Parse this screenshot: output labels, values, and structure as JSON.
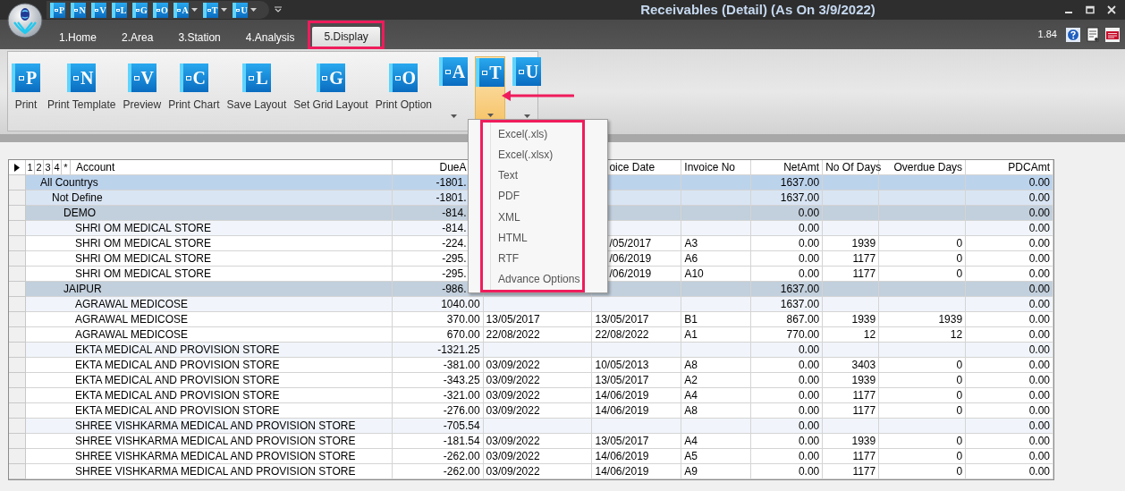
{
  "window": {
    "title": "Receivables (Detail) (As On 3/9/2022)"
  },
  "quick_access": [
    {
      "letter": "P",
      "dropdown": false
    },
    {
      "letter": "N",
      "dropdown": false
    },
    {
      "letter": "V",
      "dropdown": false
    },
    {
      "letter": "L",
      "dropdown": false
    },
    {
      "letter": "G",
      "dropdown": false
    },
    {
      "letter": "O",
      "dropdown": false
    },
    {
      "letter": "A",
      "dropdown": true
    },
    {
      "letter": "T",
      "dropdown": true
    },
    {
      "letter": "U",
      "dropdown": true
    }
  ],
  "tabs": [
    {
      "label": "1.Home",
      "selected": false
    },
    {
      "label": "2.Area",
      "selected": false
    },
    {
      "label": "3.Station",
      "selected": false
    },
    {
      "label": "4.Analysis",
      "selected": false
    },
    {
      "label": "5.Display",
      "selected": true,
      "highlighted": true
    }
  ],
  "version": "1.84",
  "ribbon": [
    {
      "kind": "large",
      "letter": "P",
      "label": "Print"
    },
    {
      "kind": "large",
      "letter": "N",
      "label": "Print Template"
    },
    {
      "kind": "large",
      "letter": "V",
      "label": "Preview"
    },
    {
      "kind": "large",
      "letter": "C",
      "label": "Print Chart"
    },
    {
      "kind": "large",
      "letter": "L",
      "label": "Save Layout"
    },
    {
      "kind": "large",
      "letter": "G",
      "label": "Set Grid Layout"
    },
    {
      "kind": "large",
      "letter": "O",
      "label": "Print Option"
    },
    {
      "kind": "split",
      "letter": "A",
      "selected": false
    },
    {
      "kind": "split",
      "letter": "T",
      "selected": true
    },
    {
      "kind": "split",
      "letter": "U",
      "selected": false
    }
  ],
  "export_menu": {
    "highlighted": true,
    "items": [
      "Excel(.xls)",
      "Excel(.xlsx)",
      "Text",
      "PDF",
      "XML",
      "HTML",
      "RTF",
      "Advance Options"
    ]
  },
  "table": {
    "group_levels": [
      "1",
      "2",
      "3",
      "4",
      "*"
    ],
    "columns": {
      "account": "Account",
      "due_amt": "DueA",
      "invoice_date": "oice Date",
      "invoice_no": "Invoice No",
      "net_amt": "NetAmt",
      "no_of_days": "No Of Days",
      "overdue_days": "Overdue Days",
      "pdc_amt": "PDCAmt"
    },
    "rows": [
      {
        "account": "All Countrys",
        "kind": "country",
        "under_menu": true,
        "cells": {
          "due_amt": "-1801.",
          "net_amt": "1637.00",
          "pdc_amt": "0.00"
        },
        "children": [
          {
            "account": "Not Define",
            "kind": "region",
            "under_menu": true,
            "cells": {
              "due_amt": "-1801.",
              "net_amt": "1637.00",
              "pdc_amt": "0.00"
            },
            "children": [
              {
                "account": "DEMO",
                "kind": "station",
                "under_menu": true,
                "cells": {
                  "due_amt": "-814.",
                  "net_amt": "0.00",
                  "pdc_amt": "0.00"
                },
                "children": [
                  {
                    "account": "SHRI OM MEDICAL STORE",
                    "kind": "subtotal",
                    "under_menu": true,
                    "cells": {
                      "due_amt": "-814.",
                      "net_amt": "0.00",
                      "pdc_amt": "0.00"
                    }
                  },
                  {
                    "account": "SHRI OM MEDICAL STORE",
                    "kind": "detail",
                    "under_menu": true,
                    "cells": {
                      "due_amt": "-224.",
                      "invoice_date": "/05/2017",
                      "invoice_no": "A3",
                      "net_amt": "0.00",
                      "no_of_days": "1939",
                      "overdue_days": "0",
                      "pdc_amt": "0.00"
                    }
                  },
                  {
                    "account": "SHRI OM MEDICAL STORE",
                    "kind": "detail",
                    "under_menu": true,
                    "cells": {
                      "due_amt": "-295.",
                      "invoice_date": "/06/2019",
                      "invoice_no": "A6",
                      "net_amt": "0.00",
                      "no_of_days": "1177",
                      "overdue_days": "0",
                      "pdc_amt": "0.00"
                    }
                  },
                  {
                    "account": "SHRI OM MEDICAL STORE",
                    "kind": "detail",
                    "under_menu": true,
                    "cells": {
                      "due_amt": "-295.",
                      "invoice_date": "/06/2019",
                      "invoice_no": "A10",
                      "net_amt": "0.00",
                      "no_of_days": "1177",
                      "overdue_days": "0",
                      "pdc_amt": "0.00"
                    }
                  }
                ]
              },
              {
                "account": "JAIPUR",
                "kind": "station",
                "under_menu": true,
                "cells": {
                  "due_amt": "-986.",
                  "net_amt": "1637.00",
                  "pdc_amt": "0.00"
                },
                "children": [
                  {
                    "account": "AGRAWAL MEDICOSE",
                    "kind": "subtotal",
                    "under_menu": false,
                    "cells": {
                      "due_amt": "1040.00",
                      "net_amt": "1637.00",
                      "pdc_amt": "0.00"
                    }
                  },
                  {
                    "account": "AGRAWAL MEDICOSE",
                    "kind": "detail",
                    "under_menu": false,
                    "cells": {
                      "due_amt": "370.00",
                      "due_date": "13/05/2017",
                      "invoice_date": "13/05/2017",
                      "invoice_no": "B1",
                      "net_amt": "867.00",
                      "no_of_days": "1939",
                      "overdue_days": "1939",
                      "pdc_amt": "0.00"
                    }
                  },
                  {
                    "account": "AGRAWAL MEDICOSE",
                    "kind": "detail",
                    "under_menu": false,
                    "cells": {
                      "due_amt": "670.00",
                      "due_date": "22/08/2022",
                      "invoice_date": "22/08/2022",
                      "invoice_no": "A1",
                      "net_amt": "770.00",
                      "no_of_days": "12",
                      "overdue_days": "12",
                      "pdc_amt": "0.00"
                    }
                  },
                  {
                    "account": "EKTA MEDICAL AND PROVISION STORE",
                    "kind": "subtotal",
                    "under_menu": false,
                    "cells": {
                      "due_amt": "-1321.25",
                      "net_amt": "0.00",
                      "pdc_amt": "0.00"
                    }
                  },
                  {
                    "account": "EKTA MEDICAL AND PROVISION STORE",
                    "kind": "detail",
                    "under_menu": false,
                    "cells": {
                      "due_amt": "-381.00",
                      "due_date": "03/09/2022",
                      "invoice_date": "10/05/2013",
                      "invoice_no": "A8",
                      "net_amt": "0.00",
                      "no_of_days": "3403",
                      "overdue_days": "0",
                      "pdc_amt": "0.00"
                    }
                  },
                  {
                    "account": "EKTA MEDICAL AND PROVISION STORE",
                    "kind": "detail",
                    "under_menu": false,
                    "cells": {
                      "due_amt": "-343.25",
                      "due_date": "03/09/2022",
                      "invoice_date": "13/05/2017",
                      "invoice_no": "A2",
                      "net_amt": "0.00",
                      "no_of_days": "1939",
                      "overdue_days": "0",
                      "pdc_amt": "0.00"
                    }
                  },
                  {
                    "account": "EKTA MEDICAL AND PROVISION STORE",
                    "kind": "detail",
                    "under_menu": false,
                    "cells": {
                      "due_amt": "-321.00",
                      "due_date": "03/09/2022",
                      "invoice_date": "14/06/2019",
                      "invoice_no": "A4",
                      "net_amt": "0.00",
                      "no_of_days": "1177",
                      "overdue_days": "0",
                      "pdc_amt": "0.00"
                    }
                  },
                  {
                    "account": "EKTA MEDICAL AND PROVISION STORE",
                    "kind": "detail",
                    "under_menu": false,
                    "cells": {
                      "due_amt": "-276.00",
                      "due_date": "03/09/2022",
                      "invoice_date": "14/06/2019",
                      "invoice_no": "A8",
                      "net_amt": "0.00",
                      "no_of_days": "1177",
                      "overdue_days": "0",
                      "pdc_amt": "0.00"
                    }
                  },
                  {
                    "account": "SHREE VISHKARMA MEDICAL AND PROVISION STORE",
                    "kind": "subtotal",
                    "under_menu": false,
                    "cells": {
                      "due_amt": "-705.54",
                      "net_amt": "0.00",
                      "pdc_amt": "0.00"
                    }
                  },
                  {
                    "account": "SHREE VISHKARMA MEDICAL AND PROVISION STORE",
                    "kind": "detail",
                    "under_menu": false,
                    "cells": {
                      "due_amt": "-181.54",
                      "due_date": "03/09/2022",
                      "invoice_date": "13/05/2017",
                      "invoice_no": "A4",
                      "net_amt": "0.00",
                      "no_of_days": "1939",
                      "overdue_days": "0",
                      "pdc_amt": "0.00"
                    }
                  },
                  {
                    "account": "SHREE VISHKARMA MEDICAL AND PROVISION STORE",
                    "kind": "detail",
                    "under_menu": false,
                    "cells": {
                      "due_amt": "-262.00",
                      "due_date": "03/09/2022",
                      "invoice_date": "14/06/2019",
                      "invoice_no": "A5",
                      "net_amt": "0.00",
                      "no_of_days": "1177",
                      "overdue_days": "0",
                      "pdc_amt": "0.00"
                    }
                  },
                  {
                    "account": "SHREE VISHKARMA MEDICAL AND PROVISION STORE",
                    "kind": "detail",
                    "under_menu": false,
                    "cells": {
                      "due_amt": "-262.00",
                      "due_date": "03/09/2022",
                      "invoice_date": "14/06/2019",
                      "invoice_no": "A9",
                      "net_amt": "0.00",
                      "no_of_days": "1177",
                      "overdue_days": "0",
                      "pdc_amt": "0.00"
                    }
                  }
                ]
              }
            ]
          }
        ]
      }
    ]
  }
}
